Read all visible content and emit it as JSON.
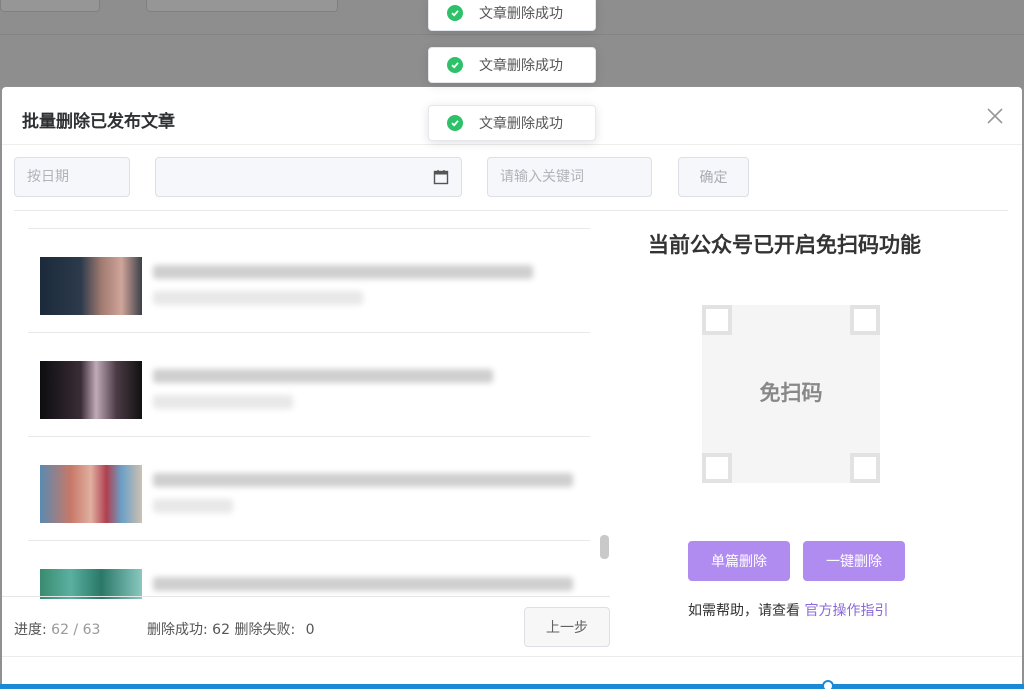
{
  "toasts": [
    {
      "text": "文章删除成功"
    },
    {
      "text": "文章删除成功"
    },
    {
      "text": "文章删除成功"
    }
  ],
  "dialog": {
    "title": "批量删除已发布文章",
    "date_placeholder": "按日期",
    "date_range_value": "",
    "keyword_placeholder": "请输入关键词",
    "confirm_label": "确定"
  },
  "right_panel": {
    "title": "当前公众号已开启免扫码功能",
    "qr_label": "免扫码",
    "single_delete_label": "单篇删除",
    "one_click_delete_label": "一键删除",
    "help_text": "如需帮助，请查看",
    "help_link": "官方操作指引"
  },
  "footer": {
    "progress_label": "进度:",
    "progress_value": "62 / 63",
    "success_label": "删除成功:",
    "success_count": "62",
    "fail_label": "删除失败:",
    "fail_count": "0",
    "prev_label": "上一步"
  },
  "colors": {
    "accent": "#b18cf0",
    "link": "#8a6ad8",
    "success": "#2ec16a"
  }
}
